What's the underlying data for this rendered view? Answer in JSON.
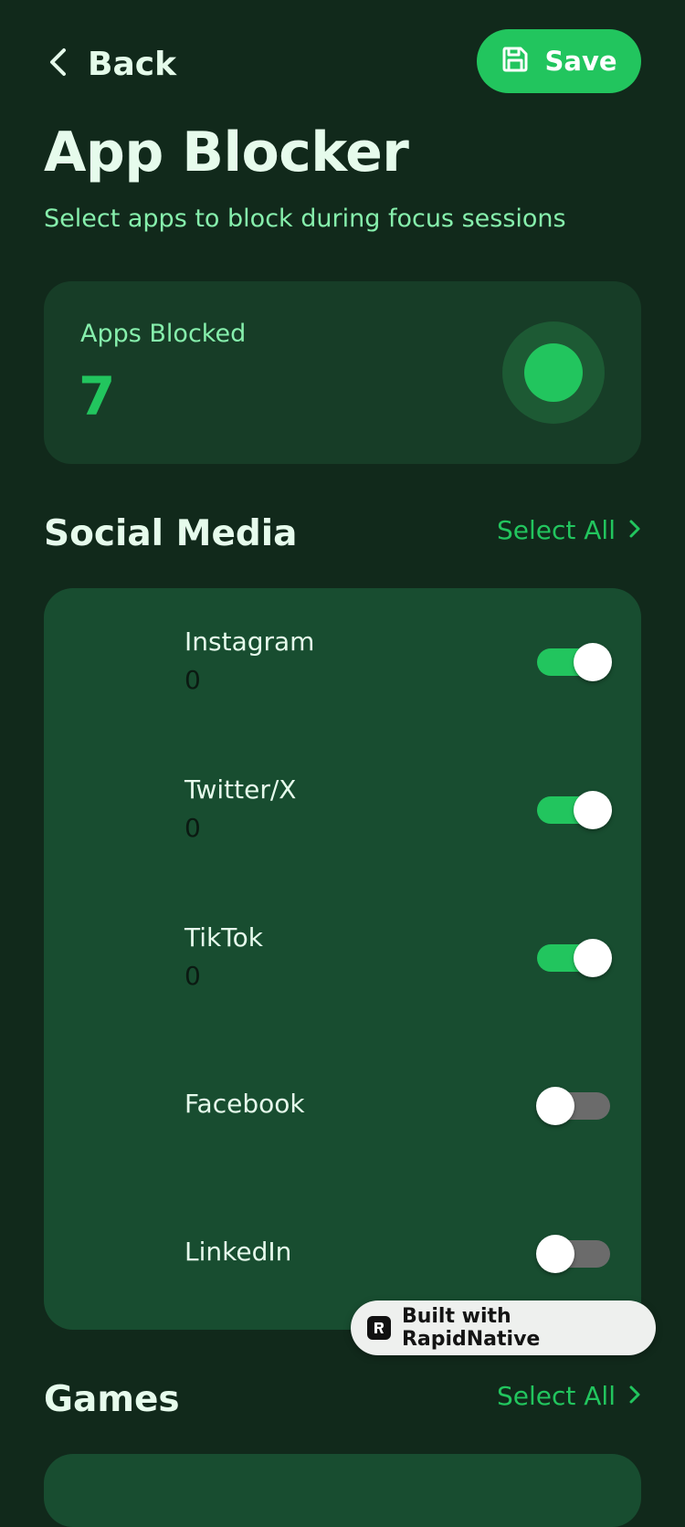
{
  "header": {
    "back_label": "Back",
    "save_label": "Save"
  },
  "page": {
    "title": "App Blocker",
    "subtitle": "Select apps to block during focus sessions"
  },
  "stats": {
    "label": "Apps Blocked",
    "value": "7"
  },
  "sections": [
    {
      "title": "Social Media",
      "select_all_label": "Select All",
      "apps": [
        {
          "name": "Instagram",
          "count": "0",
          "enabled": true
        },
        {
          "name": "Twitter/X",
          "count": "0",
          "enabled": true
        },
        {
          "name": "TikTok",
          "count": "0",
          "enabled": true
        },
        {
          "name": "Facebook",
          "enabled": false
        },
        {
          "name": "LinkedIn",
          "enabled": false
        }
      ]
    },
    {
      "title": "Games",
      "select_all_label": "Select All"
    }
  ],
  "badge": {
    "text": "Built with RapidNative"
  },
  "colors": {
    "background": "#11291b",
    "accent": "#22c55e",
    "card": "#184d30",
    "toggle_off": "#6b6b6b"
  }
}
